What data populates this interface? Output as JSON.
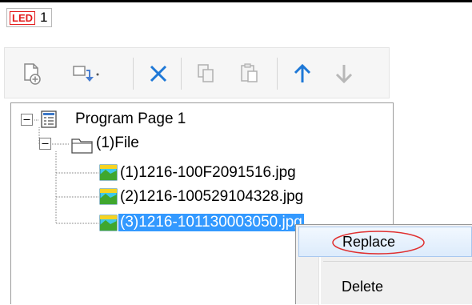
{
  "tab": {
    "badge": "LED",
    "number": "1"
  },
  "toolbar": {
    "items": [
      {
        "name": "add-page-icon",
        "enabled": true
      },
      {
        "name": "add-item-dropdown-icon",
        "enabled": true
      },
      {
        "name": "delete-icon",
        "enabled": true
      },
      {
        "name": "copy-icon",
        "enabled": false
      },
      {
        "name": "paste-icon",
        "enabled": false
      },
      {
        "name": "move-up-icon",
        "enabled": true
      },
      {
        "name": "move-down-icon",
        "enabled": false
      }
    ]
  },
  "tree": {
    "root": {
      "label": "Program Page 1",
      "expander": "⊟"
    },
    "folder": {
      "label": "(1)File",
      "expander": "⊟"
    },
    "files": [
      {
        "label": "(1)1216-100F2091516.jpg",
        "selected": false
      },
      {
        "label": "(2)1216-100529104328.jpg",
        "selected": false
      },
      {
        "label": "(3)1216-101130003050.jpg",
        "selected": true
      }
    ]
  },
  "context_menu": {
    "items": [
      {
        "label": "Replace",
        "highlighted": true
      },
      {
        "label": "Delete",
        "highlighted": false
      }
    ]
  },
  "colors": {
    "selection": "#3399ff",
    "accent_red": "#e31b1b",
    "arrow_blue": "#1e78d7"
  }
}
